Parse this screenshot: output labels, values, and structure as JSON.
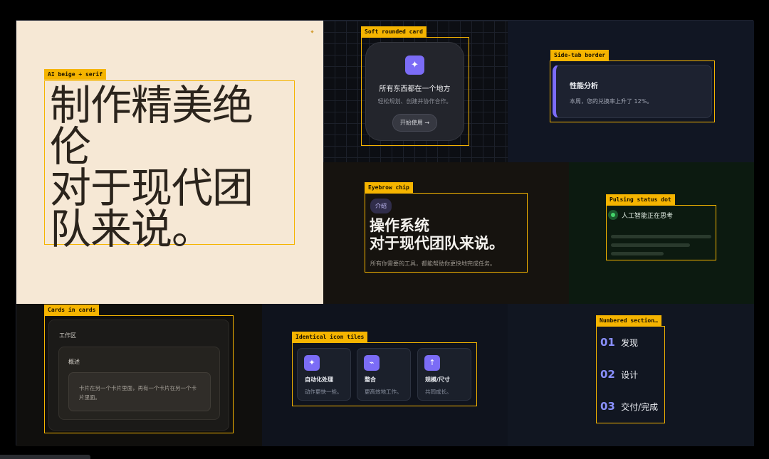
{
  "panels": {
    "beige": {
      "tag": "AI beige + serif",
      "headline": "制作精美绝\n伦\n对于现代团\n队来说。"
    },
    "soft_card": {
      "tag": "Soft rounded card",
      "icon": "sparkle-icon",
      "title": "所有东西都在一个地方",
      "subtitle": "轻松规划、创建并协作合作。",
      "button": "开始使用 →"
    },
    "side_tab": {
      "tag": "Side-tab border",
      "title": "性能分析",
      "subtitle": "本周，您的兑换率上升了 12%。"
    },
    "eyebrow": {
      "tag": "Eyebrow chip",
      "chip": "介绍",
      "headline": "操作系统\n对于现代团队来说。",
      "subtitle": "所有你需要的工具，都能帮助你更快地完成任务。"
    },
    "pulsing": {
      "tag": "Pulsing status dot",
      "status": "人工智能正在思考"
    },
    "cards_in_cards": {
      "tag": "Cards in cards",
      "outer": "工作区",
      "middle": "概述",
      "inner": "卡片在另一个卡片里面，再有一个卡片在另一个卡片里面。"
    },
    "icon_tiles": {
      "tag": "Identical icon tiles",
      "tiles": [
        {
          "icon": "sparkle-icon",
          "title": "自动化处理",
          "subtitle": "动作更快一些。"
        },
        {
          "icon": "link-icon",
          "title": "整合",
          "subtitle": "更高效地工作。"
        },
        {
          "icon": "arrow-up-icon",
          "title": "规模/尺寸",
          "subtitle": "共同成长。"
        }
      ]
    },
    "numbered": {
      "tag": "Numbered section…",
      "items": [
        {
          "num": "01",
          "label": "发现"
        },
        {
          "num": "02",
          "label": "设计"
        },
        {
          "num": "03",
          "label": "交付/完成"
        }
      ]
    }
  },
  "colors": {
    "accent": "#7b6cf6",
    "tag": "#f5b400",
    "beige": "#f6e8d5",
    "status": "#44d56b"
  }
}
